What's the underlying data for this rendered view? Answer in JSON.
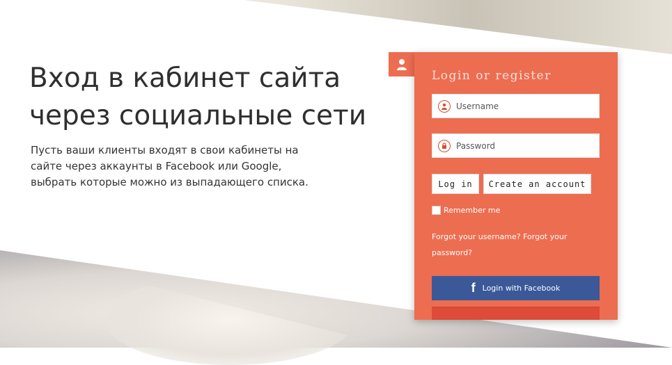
{
  "hero": {
    "title": "Вход в кабинет сайта\nчерез социальные сети",
    "description": "Пусть ваши клиенты входят в свои кабинеты на\nсайте через аккаунты в Facebook или Google,\nвыбрать которые можно из выпадающего списка."
  },
  "login": {
    "title": "Login or register",
    "username_placeholder": "Username",
    "password_placeholder": "Password",
    "login_button": "Log in",
    "create_button": "Create an account",
    "remember_label": "Remember me",
    "forgot_username": "Forgot your username?",
    "forgot_password": "Forgot your password?",
    "facebook_button": "Login with Facebook",
    "facebook_icon": "f"
  },
  "colors": {
    "panel": "#ed6d51",
    "facebook": "#3b5998",
    "google": "#dd4b39"
  },
  "icons": [
    "user-icon",
    "lock-icon",
    "avatar-icon",
    "facebook-icon"
  ]
}
